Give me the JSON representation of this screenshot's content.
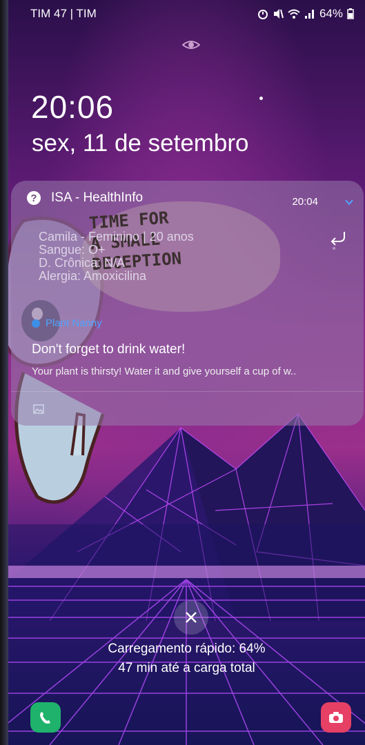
{
  "status_bar": {
    "carrier": "TIM 47 | TIM",
    "battery": "64%",
    "icons": [
      "alarm-icon",
      "mute-icon",
      "wifi-icon",
      "signal-icon",
      "battery-icon"
    ]
  },
  "lock_screen": {
    "time": "20:06",
    "date": "sex, 11 de setembro"
  },
  "notification_health": {
    "app_name": "ISA - HealthInfo",
    "time": "20:04",
    "lines": [
      "Camila - Feminino | 20 anos",
      "Sangue: O+",
      "D. Crônica: N/A",
      "Alergia: Amoxicilina"
    ]
  },
  "wallpaper_sticker": {
    "lines": [
      "TIME FOR",
      "A SMALL",
      "DECEPTION"
    ]
  },
  "notification_plant": {
    "app_name": "Plant Nanny",
    "title": "Don't forget to drink water!",
    "body": "Your plant is thirsty! Water it and give yourself a cup of w.."
  },
  "charging": {
    "line1": "Carregamento rápido: 64%",
    "line2": "47 min até a carga total"
  },
  "colors": {
    "plant_accent": "#3d8fe6",
    "phone_green": "#1fb26c",
    "camera_red": "#e64064"
  }
}
